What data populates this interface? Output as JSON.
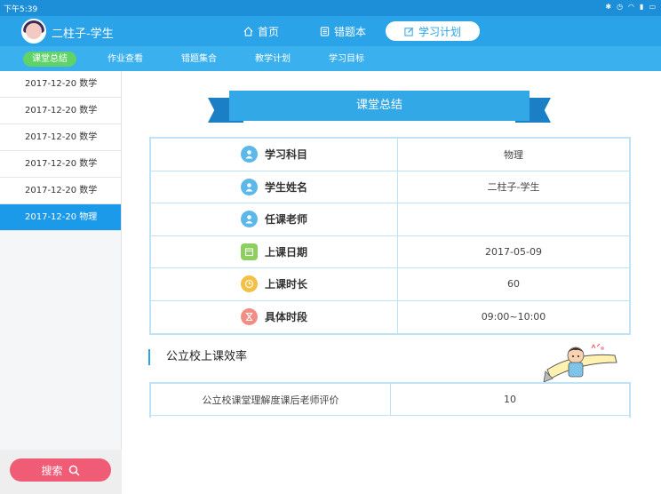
{
  "status_bar": {
    "time": "下午5:39"
  },
  "header": {
    "username": "二柱子-学生"
  },
  "tabs": [
    {
      "label": "首页"
    },
    {
      "label": "错题本"
    },
    {
      "label": "学习计划"
    }
  ],
  "subtabs": [
    {
      "label": "课堂总结"
    },
    {
      "label": "作业查看"
    },
    {
      "label": "错题集合"
    },
    {
      "label": "教学计划"
    },
    {
      "label": "学习目标"
    }
  ],
  "sidebar": {
    "items": [
      {
        "label": "2017-12-20 数学"
      },
      {
        "label": "2017-12-20 数学"
      },
      {
        "label": "2017-12-20 数学"
      },
      {
        "label": "2017-12-20 数学"
      },
      {
        "label": "2017-12-20 数学"
      },
      {
        "label": "2017-12-20 物理"
      }
    ],
    "search_label": "搜索"
  },
  "summary": {
    "title": "课堂总结",
    "rows": [
      {
        "label": "学习科目",
        "value": "物理"
      },
      {
        "label": "学生姓名",
        "value": "二柱子-学生"
      },
      {
        "label": "任课老师",
        "value": ""
      },
      {
        "label": "上课日期",
        "value": "2017-05-09"
      },
      {
        "label": "上课时长",
        "value": "60"
      },
      {
        "label": "具体时段",
        "value": "09:00~10:00"
      }
    ]
  },
  "efficiency": {
    "title": "公立校上课效率",
    "rows": [
      {
        "label": "公立校课堂理解度课后老师评价",
        "value": "10"
      }
    ]
  },
  "colors": {
    "accent": "#2aa3e8",
    "active_subtab": "#5fd268",
    "search": "#f05b76"
  }
}
